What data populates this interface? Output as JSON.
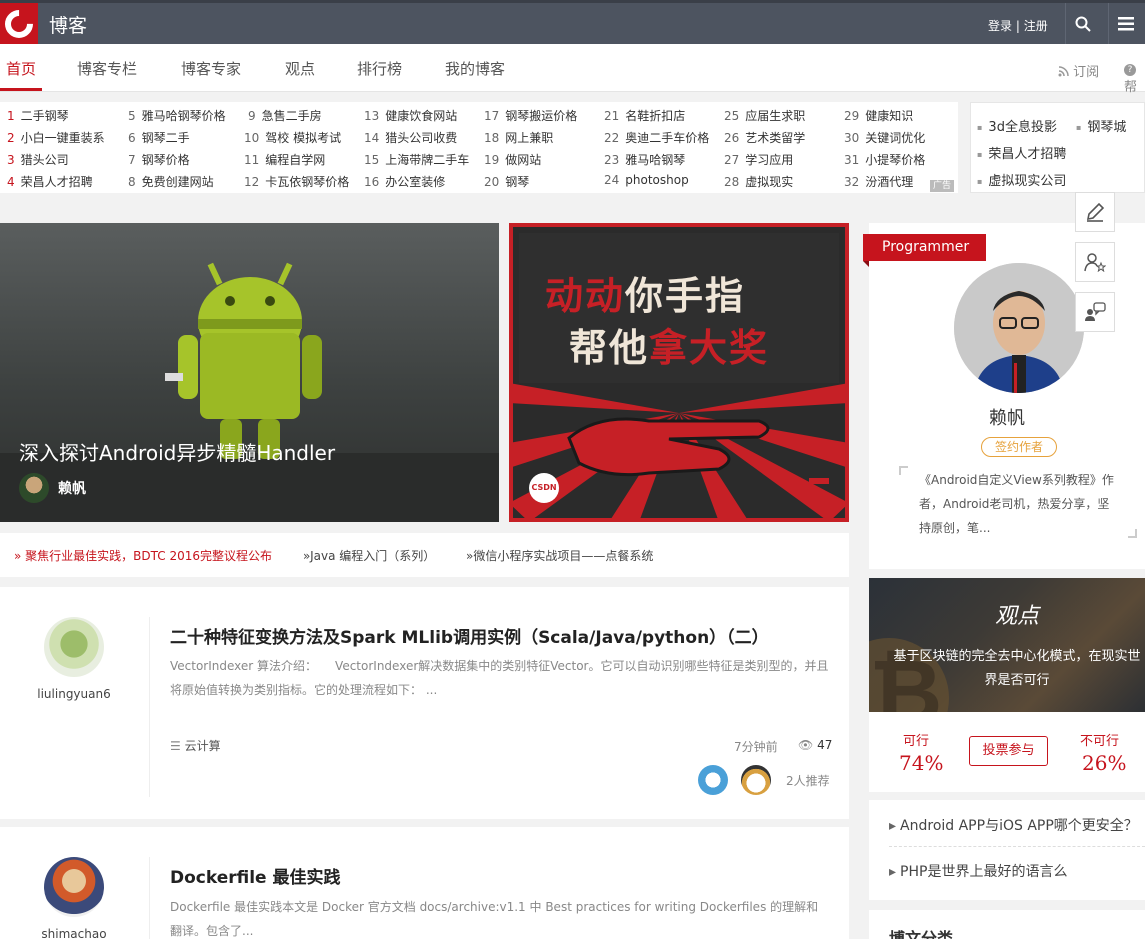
{
  "header": {
    "brand": "博客",
    "login": "登录",
    "sep": "|",
    "register": "注册"
  },
  "nav": {
    "tabs": [
      "首页",
      "博客专栏",
      "博客专家",
      "观点",
      "排行榜",
      "我的博客"
    ],
    "subscribe": "订阅",
    "help": "帮"
  },
  "ads": {
    "col1": [
      [
        "1",
        "二手钢琴"
      ],
      [
        "2",
        "小白一键重装系"
      ],
      [
        "3",
        "猎头公司"
      ],
      [
        "4",
        "荣昌人才招聘"
      ]
    ],
    "col2": [
      [
        "5",
        "雅马哈钢琴价格"
      ],
      [
        "6",
        "钢琴二手"
      ],
      [
        "7",
        "钢琴价格"
      ],
      [
        "8",
        "免费创建网站"
      ]
    ],
    "col3": [
      [
        "9",
        "急售二手房"
      ],
      [
        "10",
        "驾校 模拟考试"
      ],
      [
        "11",
        "编程自学网"
      ],
      [
        "12",
        "卡瓦依钢琴价格"
      ]
    ],
    "col4": [
      [
        "13",
        "健康饮食网站"
      ],
      [
        "14",
        "猎头公司收费"
      ],
      [
        "15",
        "上海带牌二手车"
      ],
      [
        "16",
        "办公室装修"
      ]
    ],
    "col5": [
      [
        "17",
        "钢琴搬运价格"
      ],
      [
        "18",
        "网上兼职"
      ],
      [
        "19",
        "做网站"
      ],
      [
        "20",
        "钢琴"
      ]
    ],
    "col6": [
      [
        "21",
        "名鞋折扣店"
      ],
      [
        "22",
        "奥迪二手车价格"
      ],
      [
        "23",
        "雅马哈钢琴"
      ],
      [
        "24",
        "photoshop"
      ]
    ],
    "col7": [
      [
        "25",
        "应届生求职"
      ],
      [
        "26",
        "艺术类留学"
      ],
      [
        "27",
        "学习应用"
      ],
      [
        "28",
        "虚拟现实"
      ]
    ],
    "col8": [
      [
        "29",
        "健康知识"
      ],
      [
        "30",
        "关键词优化"
      ],
      [
        "31",
        "小提琴价格"
      ],
      [
        "32",
        "汾酒代理"
      ]
    ],
    "ad_label": "广告",
    "side": [
      "3d全息投影",
      "钢琴城",
      "荣昌人才招聘",
      "虚拟现实公司"
    ]
  },
  "feature": {
    "title": "深入探讨Android异步精髓Handler",
    "author": "赖帆",
    "banner_line1a": "动动",
    "banner_line1b": "你手指",
    "banner_line2a": "帮他",
    "banner_line2b": "拿大奖",
    "banner_logo": "CSDN"
  },
  "headlines": [
    "» 聚焦行业最佳实践，BDTC 2016完整议程公布",
    "»Java 编程入门（系列）",
    "»微信小程序实战项目——点餐系统"
  ],
  "articles": [
    {
      "user": "liulingyuan6",
      "title": "二十种特征变换方法及Spark MLlib调用实例（Scala/Java/python）（二）",
      "desc": "VectorIndexer 算法介绍：　　VectorIndexer解决数据集中的类别特征Vector。它可以自动识别哪些特征是类别型的，并且将原始值转换为类别指标。它的处理流程如下：  ...",
      "category": "云计算",
      "time": "7分钟前",
      "views": "47",
      "recommend": "2人推荐"
    },
    {
      "user": "shimachao",
      "title": "Dockerfile 最佳实践",
      "desc": "Dockerfile 最佳实践本文是 Docker 官方文档 docs/archive:v1.1 中 Best practices for writing Dockerfiles 的理解和翻译。包含了..."
    }
  ],
  "profile": {
    "ribbon": "Programmer",
    "name": "赖帆",
    "badge": "签约作者",
    "bio": "《Android自定义View系列教程》作者，Android老司机，热爱分享，坚持原创，笔..."
  },
  "viewpoint": {
    "logo": "观点",
    "text": "基于区块链的完全去中心化模式，在现实世界是否可行",
    "yes_label": "可行",
    "yes_pct": "74%",
    "no_label": "不可行",
    "no_pct": "26%",
    "vote": "投票参与"
  },
  "qa": [
    "Android APP与iOS APP哪个更安全？",
    "PHP是世界上最好的语言么"
  ],
  "category_title": "博文分类",
  "colors": {
    "brand_red": "#c6141d",
    "topbar": "#4d5460",
    "badge_orange": "#e6a23c"
  }
}
